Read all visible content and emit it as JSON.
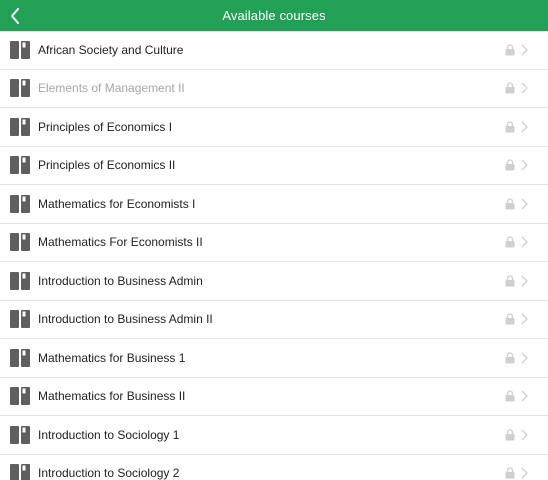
{
  "navbar": {
    "title": "Available courses",
    "back_icon": "chevron-left-icon"
  },
  "colors": {
    "header": "#22a055",
    "icon": "#5f5f5f",
    "muted": "#cfcfcf"
  },
  "courses": [
    {
      "title": "African Society and Culture",
      "locked": true,
      "dimmed": false
    },
    {
      "title": "Elements of Management II",
      "locked": true,
      "dimmed": true
    },
    {
      "title": "Principles of Economics I",
      "locked": true,
      "dimmed": false
    },
    {
      "title": "Principles of Economics II",
      "locked": true,
      "dimmed": false
    },
    {
      "title": "Mathematics for Economists I",
      "locked": true,
      "dimmed": false
    },
    {
      "title": "Mathematics For Economists II",
      "locked": true,
      "dimmed": false
    },
    {
      "title": "Introduction to Business Admin",
      "locked": true,
      "dimmed": false
    },
    {
      "title": "Introduction to Business Admin II",
      "locked": true,
      "dimmed": false
    },
    {
      "title": "Mathematics for Business 1",
      "locked": true,
      "dimmed": false
    },
    {
      "title": "Mathematics for Business II",
      "locked": true,
      "dimmed": false
    },
    {
      "title": "Introduction to Sociology 1",
      "locked": true,
      "dimmed": false
    },
    {
      "title": "Introduction to Sociology 2",
      "locked": true,
      "dimmed": false
    }
  ]
}
